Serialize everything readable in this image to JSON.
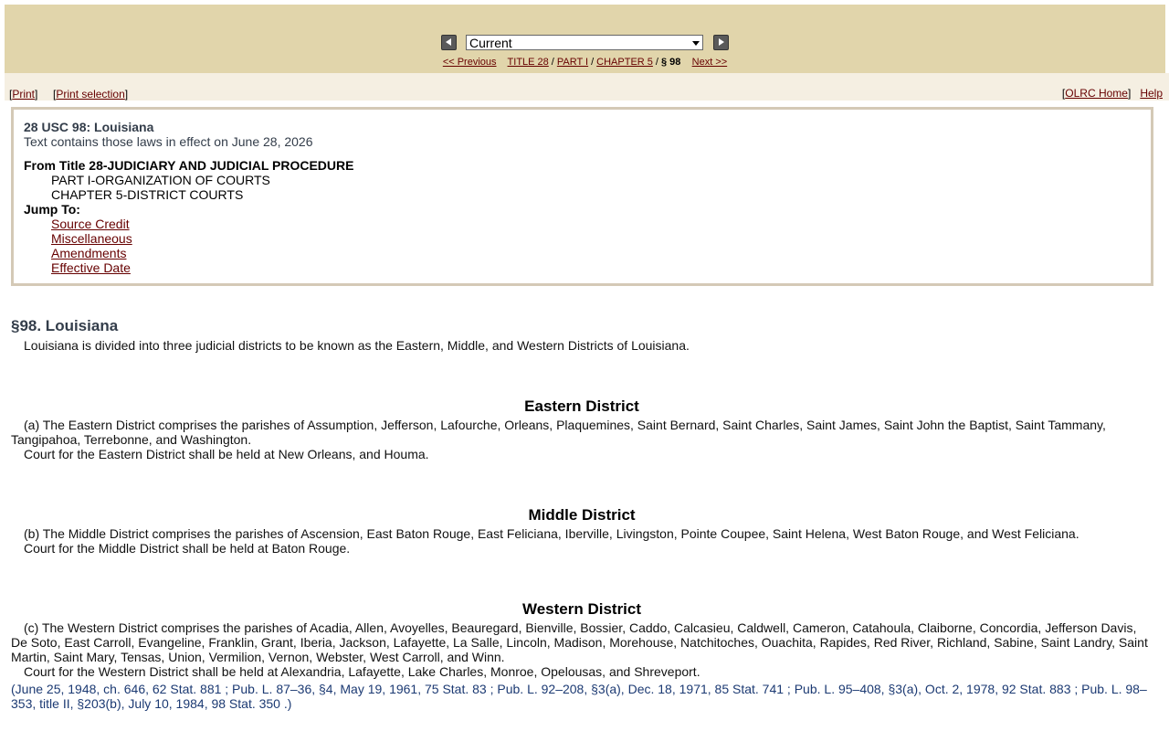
{
  "nav": {
    "select_value": "Current",
    "previous": "<< Previous",
    "title": "TITLE 28",
    "part": "PART I",
    "chapter": "CHAPTER 5",
    "section": "§ 98",
    "next": "Next >>"
  },
  "toolbar": {
    "print": "Print",
    "print_selection": "Print selection",
    "olrc_home": "OLRC Home",
    "help": "Help"
  },
  "doc": {
    "id": "28 USC 98: Louisiana",
    "effective": "Text contains those laws in effect on June 28, 2026",
    "from_title": "From Title 28-JUDICIARY AND JUDICIAL PROCEDURE",
    "part": "PART I-ORGANIZATION OF COURTS",
    "chapter": "CHAPTER 5-DISTRICT COURTS",
    "jump_to": "Jump To:",
    "jump_links": [
      "Source Credit",
      "Miscellaneous",
      "Amendments",
      "Effective Date"
    ]
  },
  "section": {
    "heading": "§98. Louisiana",
    "intro": "Louisiana is divided into three judicial districts to be known as the Eastern, Middle, and Western Districts of Louisiana.",
    "districts": [
      {
        "heading": "Eastern District",
        "text": "(a) The Eastern District comprises the parishes of Assumption, Jefferson, Lafourche, Orleans, Plaquemines, Saint Bernard, Saint Charles, Saint James, Saint John the Baptist, Saint Tammany, Tangipahoa, Terrebonne, and Washington.",
        "court": "Court for the Eastern District shall be held at New Orleans, and Houma."
      },
      {
        "heading": "Middle District",
        "text": "(b) The Middle District comprises the parishes of Ascension, East Baton Rouge, East Feliciana, Iberville, Livingston, Pointe Coupee, Saint Helena, West Baton Rouge, and West Feliciana.",
        "court": "Court for the Middle District shall be held at Baton Rouge."
      },
      {
        "heading": "Western District",
        "text": "(c) The Western District comprises the parishes of Acadia, Allen, Avoyelles, Beauregard, Bienville, Bossier, Caddo, Calcasieu, Caldwell, Cameron, Catahoula, Claiborne, Concordia, Jefferson Davis, De Soto, East Carroll, Evangeline, Franklin, Grant, Iberia, Jackson, Lafayette, La Salle, Lincoln, Madison, Morehouse, Natchitoches, Ouachita, Rapides, Red River, Richland, Sabine, Saint Landry, Saint Martin, Saint Mary, Tensas, Union, Vermilion, Vernon, Webster, West Carroll, and Winn.",
        "court": "Court for the Western District shall be held at Alexandria, Lafayette, Lake Charles, Monroe, Opelousas, and Shreveport."
      }
    ],
    "source_credit": "(June 25, 1948, ch. 646, 62 Stat. 881 ; Pub. L. 87–36, §4, May 19, 1961, 75 Stat. 83 ; Pub. L. 92–208, §3(a), Dec. 18, 1971, 85 Stat. 741 ; Pub. L. 95–408, §3(a), Oct. 2, 1978, 92 Stat. 883 ; Pub. L. 98–353, title II, §203(b), July 10, 1984, 98 Stat. 350 .)"
  },
  "colors": {
    "topbar": "#e1d5ab",
    "subbar": "#f5efe2",
    "link": "#660000",
    "heading": "#333d4a",
    "credit": "#1c3a73",
    "box_border": "#d4c9b6"
  },
  "icons": [
    "prev-arrow-icon",
    "next-arrow-icon",
    "chevron-down-icon"
  ]
}
